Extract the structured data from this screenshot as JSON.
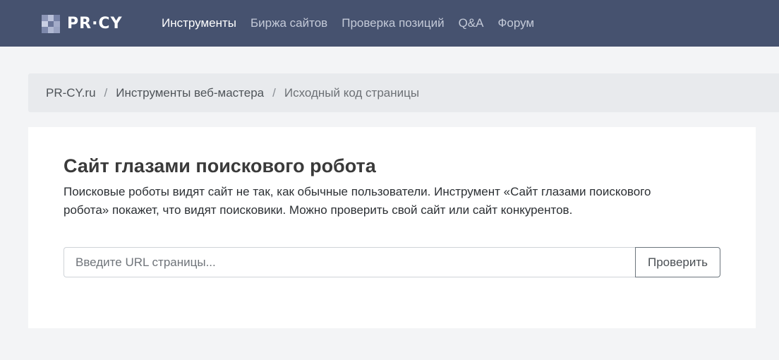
{
  "header": {
    "logo_text": "PR·CY",
    "logo_icon": "pixel-grid-icon",
    "nav": [
      {
        "label": "Инструменты",
        "active": true
      },
      {
        "label": "Биржа сайтов",
        "active": false
      },
      {
        "label": "Проверка позиций",
        "active": false
      },
      {
        "label": "Q&A",
        "active": false
      },
      {
        "label": "Форум",
        "active": false
      }
    ]
  },
  "breadcrumb": {
    "items": [
      "PR-CY.ru",
      "Инструменты веб-мастера",
      "Исходный код страницы"
    ],
    "separator": "/"
  },
  "main": {
    "title": "Сайт глазами поискового робота",
    "description": "Поисковые роботы видят сайт не так, как обычные пользователи. Инструмент «Сайт глазами поискового робота» покажет, что видят поисковики. Можно проверить свой сайт или сайт конкурентов.",
    "url_input": {
      "placeholder": "Введите URL страницы...",
      "value": ""
    },
    "submit_label": "Проверить"
  },
  "colors": {
    "header_bg": "#46526f",
    "page_bg": "#f3f4f6",
    "breadcrumb_bg": "#e8eaed",
    "card_bg": "#ffffff"
  }
}
